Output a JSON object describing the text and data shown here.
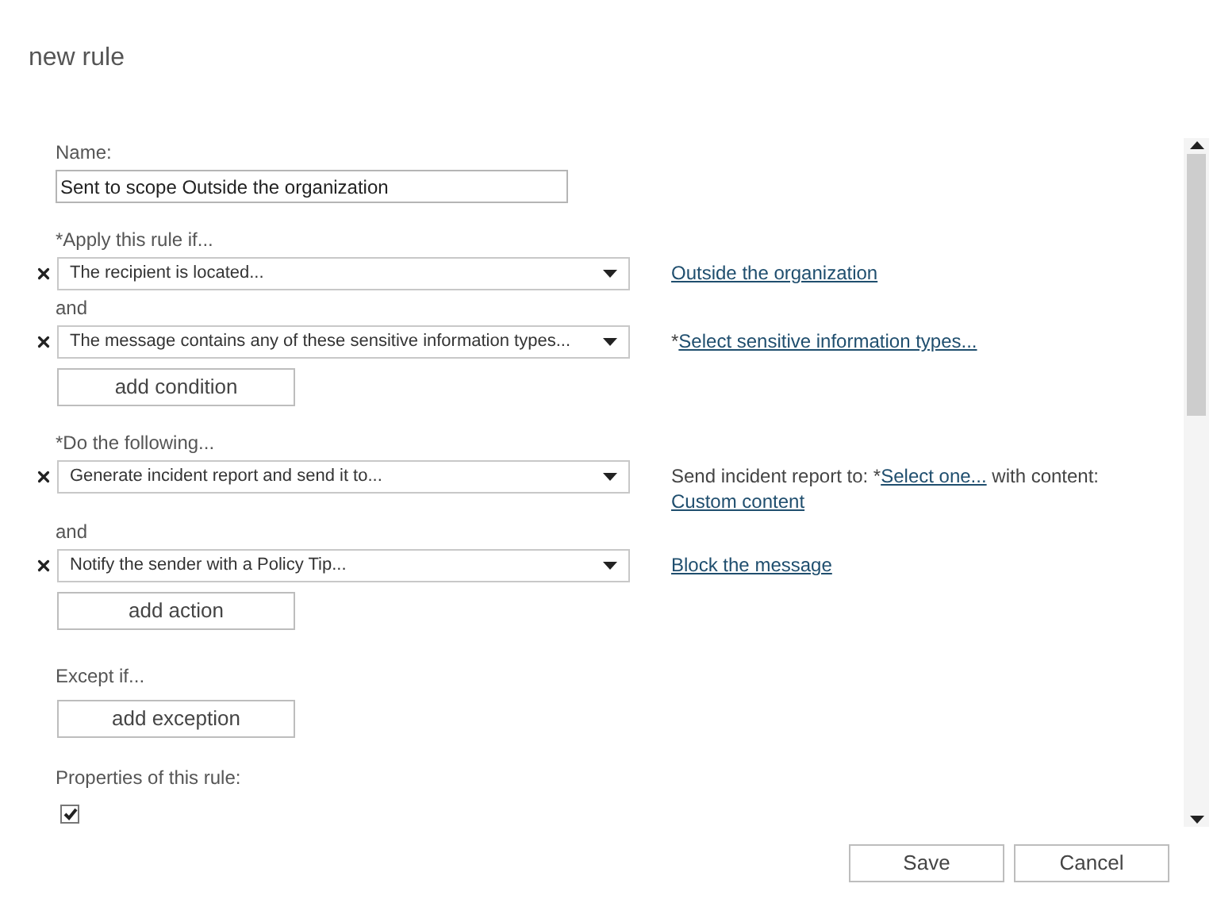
{
  "title": "new rule",
  "name_field": {
    "label": "Name:",
    "value": "Sent to scope Outside the organization"
  },
  "conditions": {
    "heading": "*Apply this rule if...",
    "rows": [
      {
        "select": "The recipient is located...",
        "detail": [
          {
            "kind": "link",
            "text": "Outside the organization"
          }
        ]
      },
      {
        "joiner": "and",
        "select": "The message contains any of these sensitive information types...",
        "detail": [
          {
            "kind": "text",
            "text": "*"
          },
          {
            "kind": "link",
            "text": "Select sensitive information types..."
          }
        ]
      }
    ],
    "add_button": "add condition"
  },
  "actions": {
    "heading": "*Do the following...",
    "rows": [
      {
        "select": "Generate incident report and send it to...",
        "detail": [
          {
            "kind": "text",
            "text": "Send incident report to: *"
          },
          {
            "kind": "link",
            "text": "Select one..."
          },
          {
            "kind": "text",
            "text": " with content: "
          },
          {
            "kind": "link",
            "text": "Custom content"
          }
        ]
      },
      {
        "joiner": "and",
        "select": "Notify the sender with a Policy Tip...",
        "detail": [
          {
            "kind": "link",
            "text": "Block the message"
          }
        ]
      }
    ],
    "add_button": "add action"
  },
  "exceptions": {
    "heading": "Except if...",
    "add_button": "add exception"
  },
  "properties": {
    "heading": "Properties of this rule:",
    "checkboxes": [
      {
        "checked": true
      }
    ]
  },
  "buttons": [
    "Save",
    "Cancel"
  ]
}
